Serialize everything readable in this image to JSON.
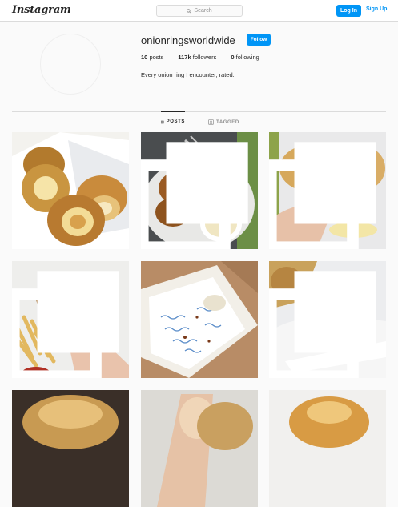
{
  "header": {
    "logo": "Instagram",
    "search_placeholder": "Search",
    "login_label": "Log In",
    "signup_label": "Sign Up"
  },
  "profile": {
    "username": "onionringsworldwide",
    "follow_label": "Follow",
    "posts_count": "10",
    "posts_label": "posts",
    "followers_count": "117k",
    "followers_label": "followers",
    "following_count": "0",
    "following_label": "following",
    "bio": "Every onion ring I encounter, rated."
  },
  "tabs": {
    "posts": "POSTS",
    "tagged": "TAGGED"
  },
  "colors": {
    "accent": "#0095f6",
    "border": "#dbdbdb",
    "text": "#262626",
    "muted": "#8e8e8e"
  },
  "grid": [
    {
      "subject": "onion rings in paper basket",
      "multi": false
    },
    {
      "subject": "onion rings in bowl with dip",
      "multi": true
    },
    {
      "subject": "hand holding onion ring",
      "multi": true
    },
    {
      "subject": "fish and chips with onion ring",
      "multi": true
    },
    {
      "subject": "paper tray on table",
      "multi": false
    },
    {
      "subject": "onion rings on paper",
      "multi": true
    },
    {
      "subject": "onion ring close-up",
      "multi": false
    },
    {
      "subject": "hand holding food",
      "multi": false
    },
    {
      "subject": "battered onion ring",
      "multi": false
    }
  ]
}
